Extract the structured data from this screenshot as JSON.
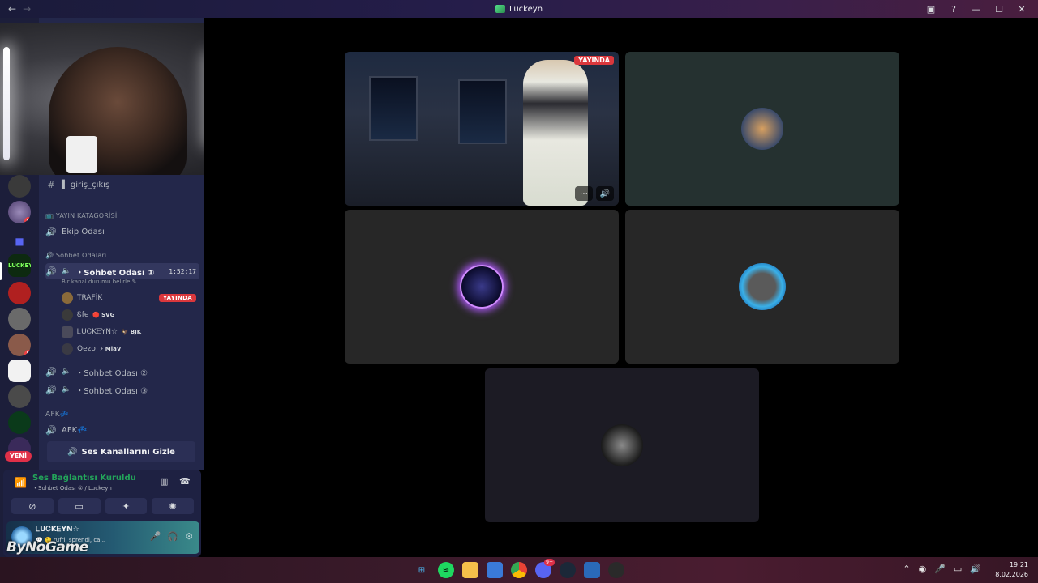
{
  "window": {
    "title": "Luckeyn",
    "back": "←",
    "forward": "→"
  },
  "rail": {
    "new_label": "YENİ",
    "badges": [
      "6",
      "5"
    ]
  },
  "sidebar": {
    "top_channel": {
      "icon": "#",
      "label": "▌ giriş_çıkış"
    },
    "cat_yayin": "📺 YAYIN KATAGORİSİ",
    "ekip": "Ekip Odası",
    "cat_sohbet": "Sohbet Odaları",
    "sohbet1": {
      "label": "・Sohbet Odası ①",
      "timer": "1:52:17",
      "status": "Bir kanal durumu belirle ✎"
    },
    "members": [
      {
        "name": "TRAFİK",
        "tag": "",
        "live": "YAYINDA",
        "color": "#8a6a3a"
      },
      {
        "name": "Ꮛfe",
        "tag": "SVG",
        "tag_icon": "🔴",
        "live": "",
        "color": "#3a3a3a"
      },
      {
        "name": "ᏞUᏟKᎬYN☆",
        "tag": "BJK",
        "tag_icon": "🦅",
        "live": "",
        "color": "#4a4a5a"
      },
      {
        "name": "Qezo",
        "tag": "MiaV",
        "tag_icon": "⚡",
        "live": "",
        "color": "#3a3a44"
      }
    ],
    "sohbet2": "・Sohbet Odası ②",
    "sohbet3": "・Sohbet Odası ③",
    "cat_afk": "AFK💤",
    "afk": "AFK💤",
    "hide_button": "Ses Kanallarını Gizle"
  },
  "voice": {
    "title": "Ses Bağlantısı Kuruldu",
    "sub": "・Sohbet Odası ① / Luckeyn"
  },
  "user": {
    "name": "ᏞUᏟKᎬYN☆",
    "status": "💬 🙂 rufri, sprendi, ca..."
  },
  "watermark": "ByNoGame",
  "stream": {
    "live": "YAYINDA",
    "more": "⋯",
    "volume": "🔊"
  },
  "clock": {
    "time": "19:21",
    "date": "8.02.2026"
  },
  "taskbar": {
    "discord_badge": "9+"
  },
  "colors": {
    "accent_green": "#23a55a",
    "live_red": "#da373c"
  }
}
